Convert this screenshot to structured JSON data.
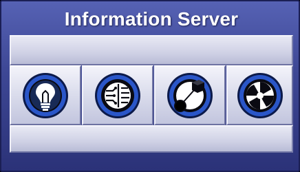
{
  "window": {
    "title": "Information Server"
  },
  "buttons": [
    {
      "icon": "lightbulb-icon"
    },
    {
      "icon": "circuit-board-icon"
    },
    {
      "icon": "ball-cube-network-icon"
    },
    {
      "icon": "aperture-icon"
    }
  ],
  "colors": {
    "panel_top": "#5662b4",
    "panel_bottom": "#2b3278",
    "icon_ring": "#1e3fa8",
    "icon_inner": "#3a6fe0",
    "bar_light": "#e8e9f4"
  }
}
